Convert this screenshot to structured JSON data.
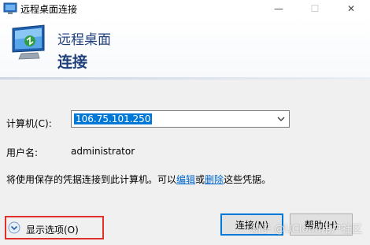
{
  "window": {
    "title": "远程桌面连接",
    "minimize_glyph": "—",
    "maximize_glyph": "☐",
    "close_glyph": "✕"
  },
  "banner": {
    "line1": "远程桌面",
    "line2": "连接"
  },
  "form": {
    "computer_label": "计算机(C):",
    "computer_value": "106.75.101.250",
    "username_label": "用户名:",
    "username_value": "administrator",
    "info_prefix": "将使用保存的凭据连接到此计算机。可以",
    "info_link_edit": "编辑",
    "info_or": "或",
    "info_link_delete": "删除",
    "info_suffix": "这些凭据。"
  },
  "footer": {
    "show_options_label": "显示选项(O)",
    "connect_label": "连接(N)",
    "help_label": "帮助(H)",
    "watermark": "知乎 @UCloud用户社区"
  },
  "colors": {
    "highlight": "#0078d7",
    "banner_text": "#1e3f7a",
    "link": "#0066cc",
    "annotation_box": "#e0312c"
  }
}
